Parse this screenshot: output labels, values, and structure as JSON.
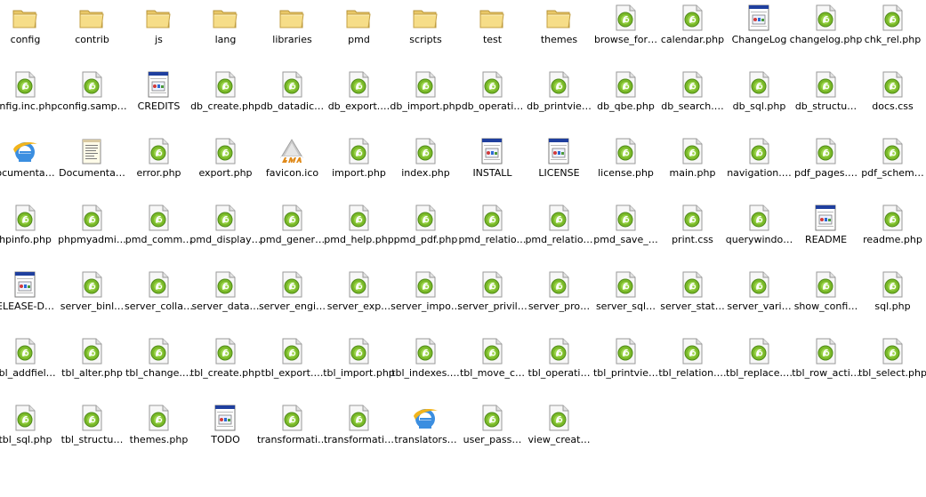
{
  "window": {
    "view": "icons"
  },
  "files": [
    {
      "name": "config",
      "icon": "folder-icon"
    },
    {
      "name": "contrib",
      "icon": "folder-icon"
    },
    {
      "name": "js",
      "icon": "folder-icon"
    },
    {
      "name": "lang",
      "icon": "folder-icon"
    },
    {
      "name": "libraries",
      "icon": "folder-icon"
    },
    {
      "name": "pmd",
      "icon": "folder-icon"
    },
    {
      "name": "scripts",
      "icon": "folder-icon"
    },
    {
      "name": "test",
      "icon": "folder-icon"
    },
    {
      "name": "themes",
      "icon": "folder-icon"
    },
    {
      "name": "browse_for…",
      "icon": "php-file-icon"
    },
    {
      "name": "calendar.php",
      "icon": "php-file-icon"
    },
    {
      "name": "ChangeLog",
      "icon": "text-file-icon"
    },
    {
      "name": "changelog.php",
      "icon": "php-file-icon"
    },
    {
      "name": "chk_rel.php",
      "icon": "php-file-icon"
    },
    {
      "name": "onfig.inc.php",
      "icon": "php-file-icon"
    },
    {
      "name": "config.samp…",
      "icon": "php-file-icon"
    },
    {
      "name": "CREDITS",
      "icon": "text-file-icon"
    },
    {
      "name": "db_create.php",
      "icon": "php-file-icon"
    },
    {
      "name": "db_datadic…",
      "icon": "php-file-icon"
    },
    {
      "name": "db_export.…",
      "icon": "php-file-icon"
    },
    {
      "name": "db_import.php",
      "icon": "php-file-icon"
    },
    {
      "name": "db_operati…",
      "icon": "php-file-icon"
    },
    {
      "name": "db_printvie…",
      "icon": "php-file-icon"
    },
    {
      "name": "db_qbe.php",
      "icon": "php-file-icon"
    },
    {
      "name": "db_search.…",
      "icon": "php-file-icon"
    },
    {
      "name": "db_sql.php",
      "icon": "php-file-icon"
    },
    {
      "name": "db_structu…",
      "icon": "php-file-icon"
    },
    {
      "name": "docs.css",
      "icon": "php-file-icon"
    },
    {
      "name": "ocumenta…",
      "icon": "ie-html-icon"
    },
    {
      "name": "Documenta…",
      "icon": "notepad-file-icon"
    },
    {
      "name": "error.php",
      "icon": "php-file-icon"
    },
    {
      "name": "export.php",
      "icon": "php-file-icon"
    },
    {
      "name": "favicon.ico",
      "icon": "pma-logo-icon"
    },
    {
      "name": "import.php",
      "icon": "php-file-icon"
    },
    {
      "name": "index.php",
      "icon": "php-file-icon"
    },
    {
      "name": "INSTALL",
      "icon": "text-file-icon"
    },
    {
      "name": "LICENSE",
      "icon": "text-file-icon"
    },
    {
      "name": "license.php",
      "icon": "php-file-icon"
    },
    {
      "name": "main.php",
      "icon": "php-file-icon"
    },
    {
      "name": "navigation.…",
      "icon": "php-file-icon"
    },
    {
      "name": "pdf_pages.…",
      "icon": "php-file-icon"
    },
    {
      "name": "pdf_schem…",
      "icon": "php-file-icon"
    },
    {
      "name": "hpinfo.php",
      "icon": "php-file-icon"
    },
    {
      "name": "phpmyadmi…",
      "icon": "php-file-icon"
    },
    {
      "name": "pmd_comm…",
      "icon": "php-file-icon"
    },
    {
      "name": "pmd_display…",
      "icon": "php-file-icon"
    },
    {
      "name": "pmd_gener…",
      "icon": "php-file-icon"
    },
    {
      "name": "pmd_help.php",
      "icon": "php-file-icon"
    },
    {
      "name": "pmd_pdf.php",
      "icon": "php-file-icon"
    },
    {
      "name": "pmd_relatio…",
      "icon": "php-file-icon"
    },
    {
      "name": "pmd_relatio…",
      "icon": "php-file-icon"
    },
    {
      "name": "pmd_save_…",
      "icon": "php-file-icon"
    },
    {
      "name": "print.css",
      "icon": "php-file-icon"
    },
    {
      "name": "querywindo…",
      "icon": "php-file-icon"
    },
    {
      "name": "README",
      "icon": "text-file-icon"
    },
    {
      "name": "readme.php",
      "icon": "php-file-icon"
    },
    {
      "name": "ELEASE-D…",
      "icon": "text-file-icon"
    },
    {
      "name": "server_binl…",
      "icon": "php-file-icon"
    },
    {
      "name": "server_colla…",
      "icon": "php-file-icon"
    },
    {
      "name": "server_data…",
      "icon": "php-file-icon"
    },
    {
      "name": "server_engi…",
      "icon": "php-file-icon"
    },
    {
      "name": "server_exp…",
      "icon": "php-file-icon"
    },
    {
      "name": "server_impo…",
      "icon": "php-file-icon"
    },
    {
      "name": "server_privil…",
      "icon": "php-file-icon"
    },
    {
      "name": "server_pro…",
      "icon": "php-file-icon"
    },
    {
      "name": "server_sql…",
      "icon": "php-file-icon"
    },
    {
      "name": "server_stat…",
      "icon": "php-file-icon"
    },
    {
      "name": "server_vari…",
      "icon": "php-file-icon"
    },
    {
      "name": "show_confi…",
      "icon": "php-file-icon"
    },
    {
      "name": "sql.php",
      "icon": "php-file-icon"
    },
    {
      "name": "tbl_addfiel…",
      "icon": "php-file-icon"
    },
    {
      "name": "tbl_alter.php",
      "icon": "php-file-icon"
    },
    {
      "name": "tbl_change.…",
      "icon": "php-file-icon"
    },
    {
      "name": "tbl_create.php",
      "icon": "php-file-icon"
    },
    {
      "name": "tbl_export.…",
      "icon": "php-file-icon"
    },
    {
      "name": "tbl_import.php",
      "icon": "php-file-icon"
    },
    {
      "name": "tbl_indexes.…",
      "icon": "php-file-icon"
    },
    {
      "name": "tbl_move_c…",
      "icon": "php-file-icon"
    },
    {
      "name": "tbl_operati…",
      "icon": "php-file-icon"
    },
    {
      "name": "tbl_printvie…",
      "icon": "php-file-icon"
    },
    {
      "name": "tbl_relation.…",
      "icon": "php-file-icon"
    },
    {
      "name": "tbl_replace.…",
      "icon": "php-file-icon"
    },
    {
      "name": "tbl_row_acti…",
      "icon": "php-file-icon"
    },
    {
      "name": "tbl_select.php",
      "icon": "php-file-icon"
    },
    {
      "name": "tbl_sql.php",
      "icon": "php-file-icon"
    },
    {
      "name": "tbl_structu…",
      "icon": "php-file-icon"
    },
    {
      "name": "themes.php",
      "icon": "php-file-icon"
    },
    {
      "name": "TODO",
      "icon": "text-file-icon"
    },
    {
      "name": "transformati…",
      "icon": "php-file-icon"
    },
    {
      "name": "transformati…",
      "icon": "php-file-icon"
    },
    {
      "name": "translators…",
      "icon": "ie-html-icon"
    },
    {
      "name": "user_pass…",
      "icon": "php-file-icon"
    },
    {
      "name": "view_creat…",
      "icon": "php-file-icon"
    }
  ]
}
